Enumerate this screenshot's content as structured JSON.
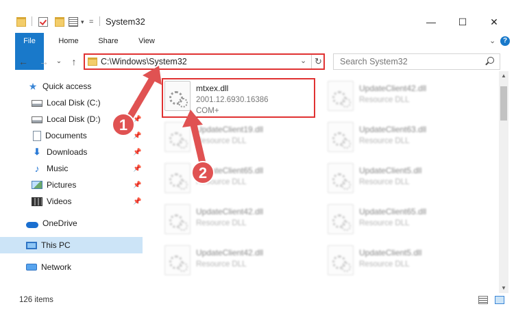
{
  "window": {
    "title": "System32",
    "quick_access_toolbar_dropdown": "=",
    "minimize_glyph": "—",
    "maximize_glyph": "☐",
    "close_glyph": "✕"
  },
  "ribbon": {
    "tabs": [
      {
        "label": "File"
      },
      {
        "label": "Home"
      },
      {
        "label": "Share"
      },
      {
        "label": "View"
      }
    ],
    "collapse_glyph": "⌄",
    "help_glyph": "?"
  },
  "navigation": {
    "back_glyph": "←",
    "forward_glyph": "→",
    "recent_glyph": "⌄",
    "up_glyph": "↑"
  },
  "address_bar": {
    "path": "C:\\Windows\\System32",
    "dropdown_glyph": "⌄",
    "refresh_glyph": "↻"
  },
  "search": {
    "placeholder": "Search System32"
  },
  "sidebar": {
    "items": [
      {
        "label": "Quick access",
        "icon": "star-icon"
      },
      {
        "label": "Local Disk (C:)",
        "icon": "disk-icon",
        "pinned": true
      },
      {
        "label": "Local Disk (D:)",
        "icon": "disk-icon",
        "pinned": true
      },
      {
        "label": "Documents",
        "icon": "documents-icon",
        "pinned": true
      },
      {
        "label": "Downloads",
        "icon": "downloads-icon",
        "pinned": true
      },
      {
        "label": "Music",
        "icon": "music-icon",
        "pinned": true
      },
      {
        "label": "Pictures",
        "icon": "pictures-icon",
        "pinned": true
      },
      {
        "label": "Videos",
        "icon": "videos-icon",
        "pinned": true
      },
      {
        "label": "OneDrive",
        "icon": "onedrive-icon"
      },
      {
        "label": "This PC",
        "icon": "this-pc-icon",
        "selected": true
      },
      {
        "label": "Network",
        "icon": "network-icon"
      }
    ],
    "pin_glyph": "📌"
  },
  "files": {
    "highlighted": {
      "name": "mtxex.dll",
      "version": "2001.12.6930.16386",
      "description": "COM+"
    },
    "others": [
      {
        "name": "UpdateClient42.dll",
        "type": "Resource DLL"
      },
      {
        "name": "UpdateClient19.dll",
        "type": "Resource DLL"
      },
      {
        "name": "UpdateClient63.dll",
        "type": "Resource DLL"
      },
      {
        "name": "UpdateClient65.dll",
        "type": "Resource DLL"
      },
      {
        "name": "UpdateClient5.dll",
        "type": "Resource DLL"
      },
      {
        "name": "UpdateClient42.dll",
        "type": "Resource DLL"
      },
      {
        "name": "UpdateClient65.dll",
        "type": "Resource DLL"
      },
      {
        "name": "UpdateClient42.dll",
        "type": "Resource DLL"
      },
      {
        "name": "UpdateClient5.dll",
        "type": "Resource DLL"
      }
    ]
  },
  "status_bar": {
    "item_count": "126 items"
  },
  "annotations": {
    "step1": "1",
    "step2": "2",
    "color": "#e03131"
  }
}
